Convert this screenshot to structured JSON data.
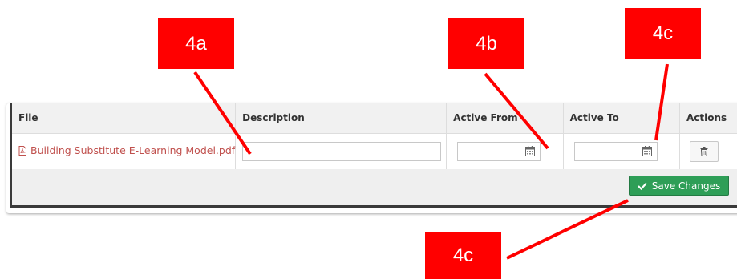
{
  "table": {
    "headers": {
      "file": "File",
      "description": "Description",
      "active_from": "Active From",
      "active_to": "Active To",
      "actions": "Actions"
    },
    "rows": [
      {
        "file_name": "Building Substitute E-Learning Model.pdf",
        "description_value": "",
        "active_from_value": "",
        "active_to_value": ""
      }
    ]
  },
  "footer": {
    "save_label": "Save Changes"
  },
  "callouts": {
    "a": "4a",
    "b": "4b",
    "c_top": "4c",
    "c_bottom": "4c"
  },
  "colors": {
    "callout": "#ff0000",
    "save_button": "#2e9e57",
    "file_link": "#c0504d"
  }
}
